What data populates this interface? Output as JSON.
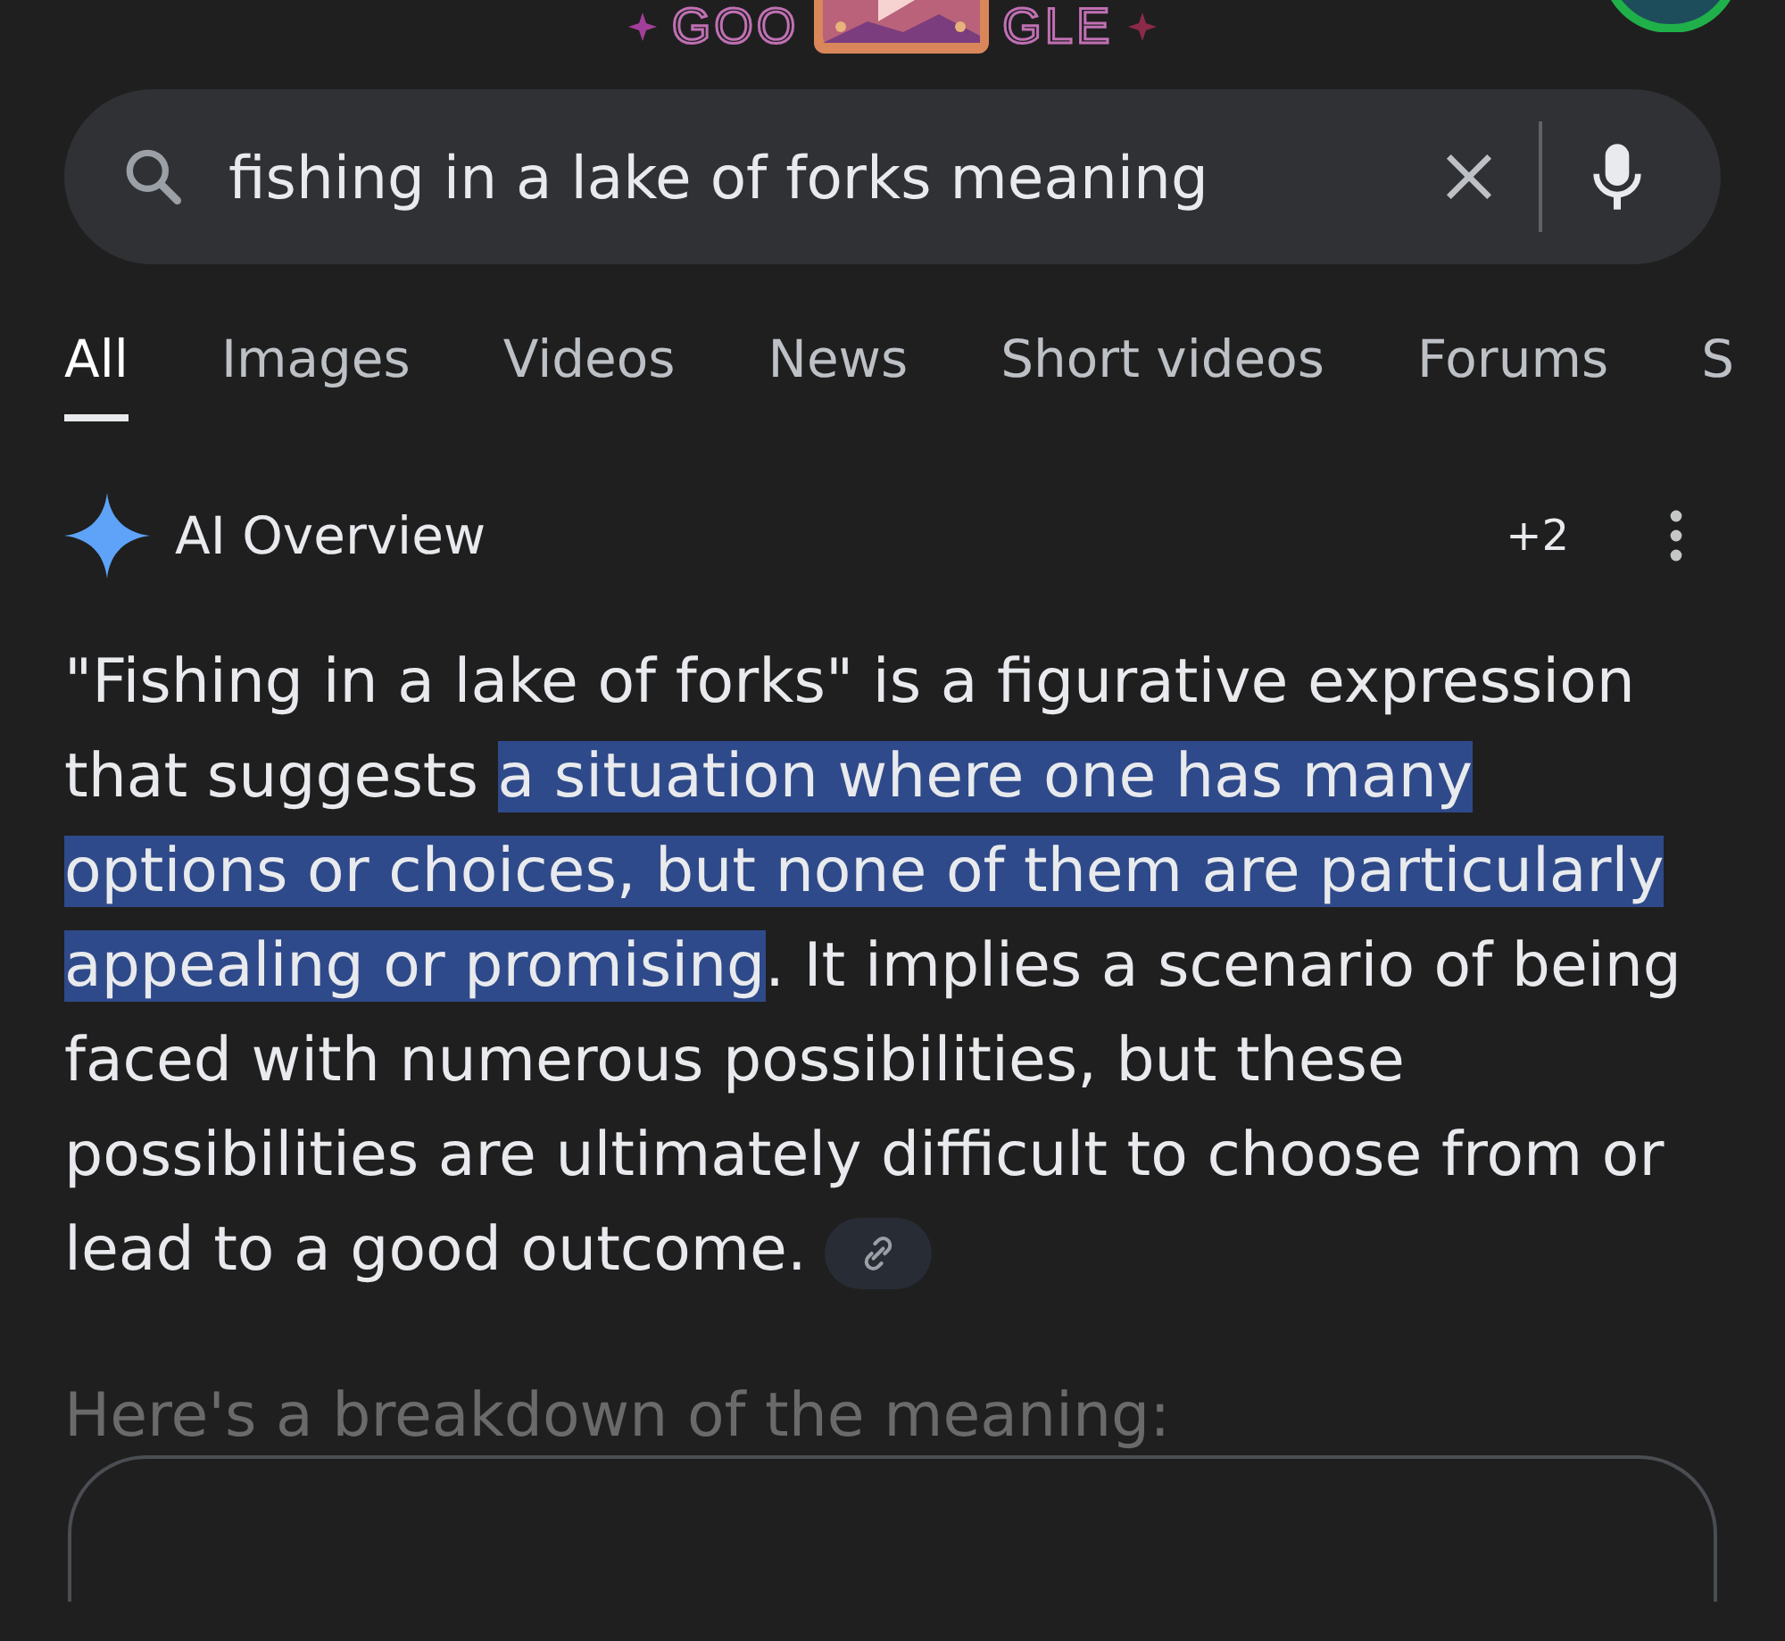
{
  "logo": {
    "left": "GOO",
    "right": "GLE"
  },
  "search": {
    "value": "fishing in a lake of forks meaning"
  },
  "tabs": [
    {
      "label": "All",
      "selected": true
    },
    {
      "label": "Images",
      "selected": false
    },
    {
      "label": "Videos",
      "selected": false
    },
    {
      "label": "News",
      "selected": false
    },
    {
      "label": "Short videos",
      "selected": false
    },
    {
      "label": "Forums",
      "selected": false
    },
    {
      "label": "S",
      "selected": false
    }
  ],
  "overview": {
    "title": "AI Overview",
    "sources": "+2",
    "paragraph": [
      {
        "text": "\"Fishing in a lake of forks\" is a figurative expression that suggests ",
        "highlighted": false
      },
      {
        "text": "a situation where one has many options or choices, but none of them are particularly appealing or promising",
        "highlighted": true
      },
      {
        "text": ". It implies a scenario of being faced with numerous possibilities, but these possibilities are ultimately difficult to choose from or lead to a good outcome.",
        "highlighted": false
      }
    ],
    "next_heading": "Here's a breakdown of the meaning:"
  }
}
